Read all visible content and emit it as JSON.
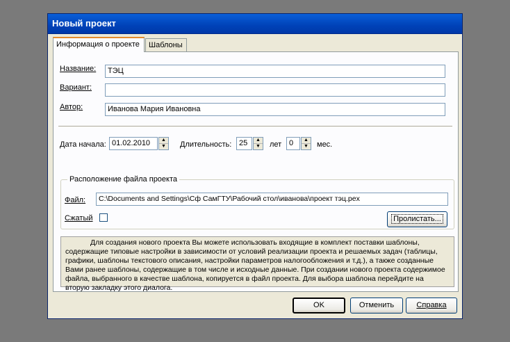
{
  "window": {
    "title": "Новый проект"
  },
  "tabs": [
    {
      "label": "Информация о проекте",
      "active": true
    },
    {
      "label": "Шаблоны",
      "active": false
    }
  ],
  "form": {
    "name_label": "Название:",
    "name_value": "ТЭЦ",
    "variant_label": "Вариант:",
    "variant_value": "",
    "author_label": "Автор:",
    "author_value": "Иванова Мария Ивановна",
    "start_date_label": "Дата начала:",
    "start_date_value": "01.02.2010",
    "duration_label": "Длительность:",
    "duration_years": "25",
    "years_unit": "лет",
    "duration_months": "0",
    "months_unit": "мес."
  },
  "file_group": {
    "title": "Расположение файла проекта",
    "file_label": "Файл:",
    "file_path": "C:\\Documents and Settings\\Сф СамГТУ\\Рабочий стол\\иванова\\проект тэц.pex",
    "compressed_label": "Сжатый",
    "compressed_checked": false,
    "browse_label": "Пролистать..."
  },
  "info_text": "Для создания нового проекта Вы можете использовать входящие в комплект поставки шаблоны, содержащие типовые настройки в зависимости от условий реализации проекта и решаемых задач (таблицы, графики, шаблоны текстового описания, настройки параметров налогообложения и т.д.), а также созданные Вами ранее шаблоны, содержащие в том числе и исходные данные. При создании нового проекта содержимое файла, выбранного в качестве шаблона, копируется в файл проекта. Для выбора шаблона перейдите на вторую закладку этого диалога.",
  "buttons": {
    "ok": "OK",
    "cancel": "Отменить",
    "help": "Справка"
  },
  "colors": {
    "titlebar": "#0054e3",
    "dialog_bg": "#ece9d8",
    "panel_bg": "#fcfcfe",
    "desktop": "#7a7a7a"
  }
}
